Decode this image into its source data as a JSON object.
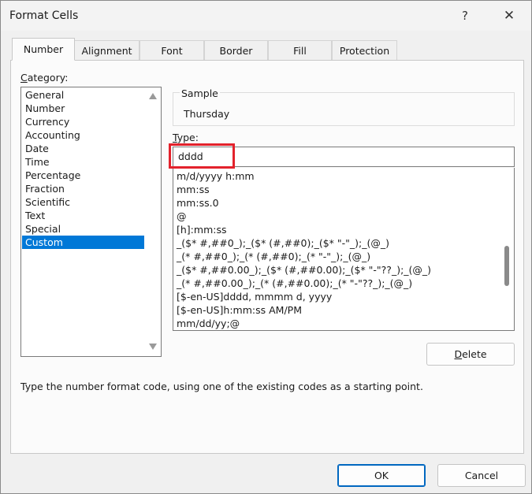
{
  "window": {
    "title": "Format Cells",
    "help_glyph": "?",
    "close_glyph": "✕"
  },
  "tabs": [
    {
      "label": "Number",
      "active": true
    },
    {
      "label": "Alignment",
      "active": false
    },
    {
      "label": "Font",
      "active": false
    },
    {
      "label": "Border",
      "active": false
    },
    {
      "label": "Fill",
      "active": false
    },
    {
      "label": "Protection",
      "active": false
    }
  ],
  "category": {
    "label_first": "C",
    "label_rest": "ategory:",
    "items": [
      "General",
      "Number",
      "Currency",
      "Accounting",
      "Date",
      "Time",
      "Percentage",
      "Fraction",
      "Scientific",
      "Text",
      "Special",
      "Custom"
    ],
    "selected": "Custom"
  },
  "sample": {
    "label": "Sample",
    "value": "Thursday"
  },
  "type": {
    "label_first": "T",
    "label_rest": "ype:",
    "value": "dddd",
    "list": [
      "m/d/yyyy h:mm",
      "mm:ss",
      "mm:ss.0",
      "@",
      "[h]:mm:ss",
      "_($* #,##0_);_($* (#,##0);_($* \"-\"_);_(@_)",
      "_(* #,##0_);_(* (#,##0);_(* \"-\"_);_(@_)",
      "_($* #,##0.00_);_($* (#,##0.00);_($* \"-\"??_);_(@_)",
      "_(* #,##0.00_);_(* (#,##0.00);_(* \"-\"??_);_(@_)",
      "[$-en-US]dddd, mmmm d, yyyy",
      "[$-en-US]h:mm:ss AM/PM",
      "mm/dd/yy;@"
    ],
    "scroll_position": 0.65
  },
  "buttons": {
    "delete_first": "D",
    "delete_rest": "elete",
    "ok": "OK",
    "cancel": "Cancel"
  },
  "hint": "Type the number format code, using one of the existing codes as a starting point.",
  "colors": {
    "selection": "#0078d7",
    "highlight_border": "#e3222c",
    "ok_border": "#0067c0"
  }
}
